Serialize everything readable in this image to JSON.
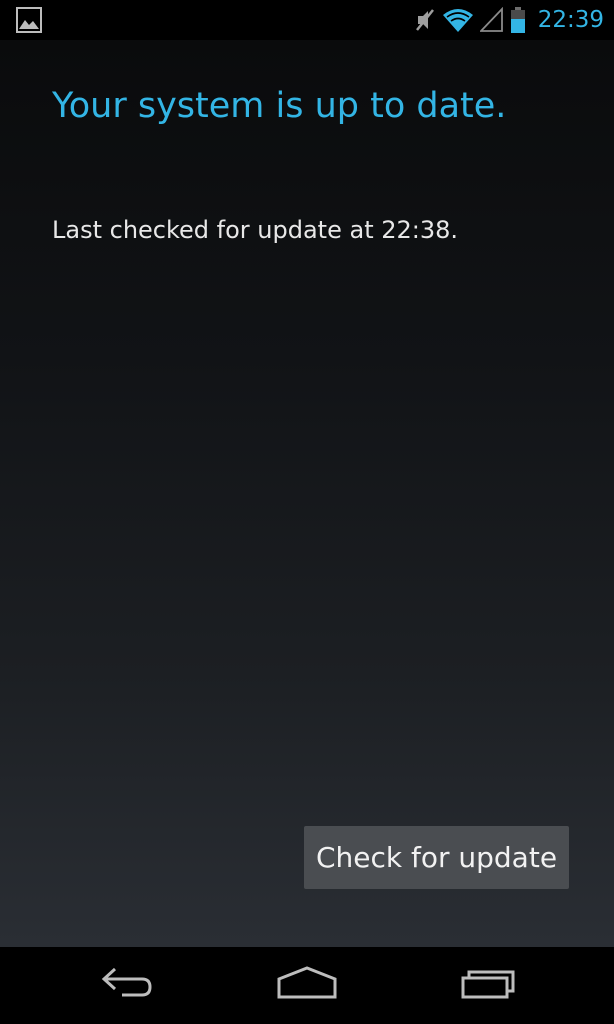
{
  "status_bar": {
    "time": "22:39",
    "icons": [
      "gallery-notification-icon",
      "mute-icon",
      "wifi-icon",
      "cell-signal-icon",
      "battery-icon"
    ]
  },
  "main": {
    "title": "Your system is up to date.",
    "last_checked": "Last checked for update at 22:38.",
    "check_button_label": "Check for update"
  },
  "nav_bar": {
    "buttons": [
      "back-icon",
      "home-icon",
      "recents-icon"
    ]
  },
  "colors": {
    "accent": "#33b5e5",
    "button_bg": "#4a4d51",
    "text": "#e8e8e8",
    "battery_fill": "#33b5e5"
  }
}
